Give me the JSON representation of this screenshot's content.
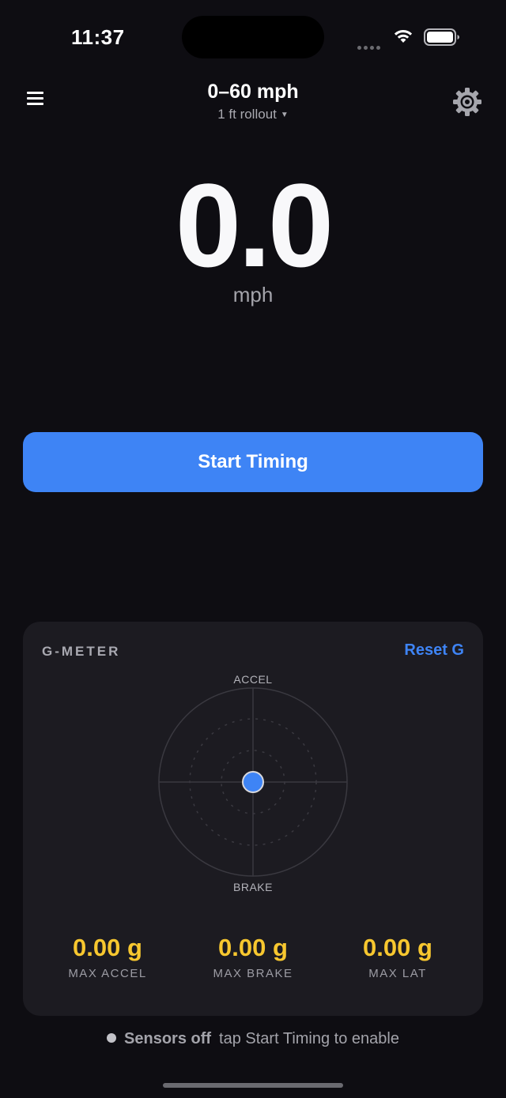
{
  "status_bar": {
    "time": "11:37"
  },
  "nav": {
    "title": "0–60 mph",
    "subtitle": "1 ft rollout",
    "menu_icon": "hamburger-menu-icon",
    "settings_icon": "gear-icon"
  },
  "speed": {
    "value": "0.0",
    "unit": "mph"
  },
  "start_button": {
    "label": "Start Timing"
  },
  "gmeter": {
    "title": "G-METER",
    "reset_label": "Reset G",
    "accel_label": "ACCEL",
    "brake_label": "BRAKE",
    "indicator_g": {
      "lateral": 0.0,
      "longitudinal": 0.0
    },
    "stats": [
      {
        "value": "0.00 g",
        "label": "MAX ACCEL"
      },
      {
        "value": "0.00 g",
        "label": "MAX BRAKE"
      },
      {
        "value": "0.00 g",
        "label": "MAX LAT"
      }
    ]
  },
  "sensor_status": {
    "state": "Sensors off",
    "hint": "tap Start Timing to enable"
  },
  "colors": {
    "background": "#0e0d12",
    "card": "#1c1b21",
    "accent_blue": "#3e84f5",
    "stat_yellow": "#f7c72f"
  }
}
